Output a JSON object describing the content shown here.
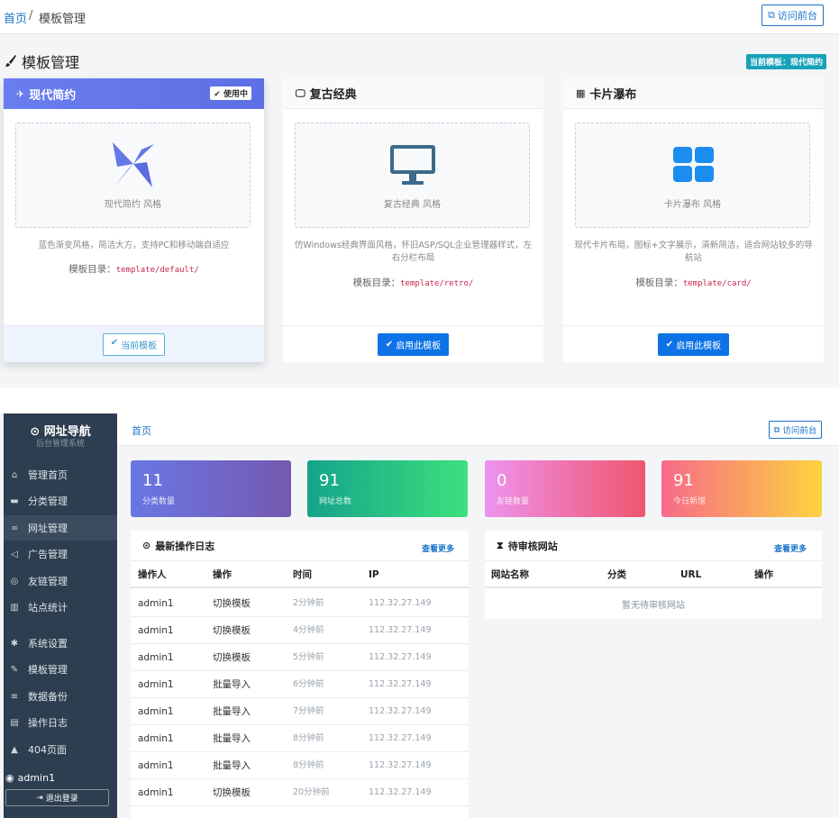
{
  "header": {
    "breadcrumb_home": "首页",
    "breadcrumb_sep": "/",
    "breadcrumb_current": "模板管理",
    "visit_button": "访问前台"
  },
  "page": {
    "title": "模板管理",
    "current_badge": "当前模板：现代简约"
  },
  "templates": [
    {
      "name": "现代简约",
      "badge": "使用中",
      "preview_label": "现代简约 风格",
      "desc": "蓝色渐变风格，简洁大方，支持PC和移动端自适应",
      "dir_label": "模板目录：",
      "dir": "template/default/",
      "button": "当前模板",
      "icon": "paper-plane-icon",
      "active": true
    },
    {
      "name": "复古经典",
      "preview_label": "复古经典 风格",
      "desc": "仿Windows经典界面风格，怀旧ASP/SQL企业管理器样式，左右分栏布局",
      "dir_label": "模板目录：",
      "dir": "template/retro/",
      "button": "启用此模板",
      "icon": "monitor-icon",
      "active": false
    },
    {
      "name": "卡片瀑布",
      "preview_label": "卡片瀑布 风格",
      "desc": "现代卡片布局，图标+文字展示，清新简洁，适合网站较多的导航站",
      "dir_label": "模板目录：",
      "dir": "template/card/",
      "button": "启用此模板",
      "icon": "grid-icon",
      "active": false
    }
  ],
  "sidebar": {
    "brand": "网址导航",
    "subtitle": "后台管理系统",
    "items": [
      {
        "label": "管理首页",
        "icon": "home-icon"
      },
      {
        "label": "分类管理",
        "icon": "folder-icon"
      },
      {
        "label": "网址管理",
        "icon": "link-icon"
      },
      {
        "label": "广告管理",
        "icon": "bullhorn-icon"
      },
      {
        "label": "友链管理",
        "icon": "handshake-icon"
      },
      {
        "label": "站点统计",
        "icon": "bar-chart-icon"
      },
      {
        "label": "系统设置",
        "icon": "gear-icon"
      },
      {
        "label": "模板管理",
        "icon": "brush-icon"
      },
      {
        "label": "数据备份",
        "icon": "database-icon"
      },
      {
        "label": "操作日志",
        "icon": "file-icon"
      },
      {
        "label": "404页面",
        "icon": "warning-icon"
      }
    ],
    "user": "admin1",
    "logout": "退出登录"
  },
  "dashboard": {
    "breadcrumb": "首页",
    "visit_button": "访问前台",
    "stats": [
      {
        "value": "11",
        "label": "分类数量"
      },
      {
        "value": "91",
        "label": "网址总数"
      },
      {
        "value": "0",
        "label": "友链数量"
      },
      {
        "value": "91",
        "label": "今日新增"
      }
    ],
    "log": {
      "title": "最新操作日志",
      "more": "查看更多",
      "columns": [
        "操作人",
        "操作",
        "时间",
        "IP"
      ],
      "rows": [
        [
          "admin1",
          "切换模板",
          "2分钟前",
          "112.32.27.149"
        ],
        [
          "admin1",
          "切换模板",
          "4分钟前",
          "112.32.27.149"
        ],
        [
          "admin1",
          "切换模板",
          "5分钟前",
          "112.32.27.149"
        ],
        [
          "admin1",
          "批量导入",
          "6分钟前",
          "112.32.27.149"
        ],
        [
          "admin1",
          "批量导入",
          "7分钟前",
          "112.32.27.149"
        ],
        [
          "admin1",
          "批量导入",
          "8分钟前",
          "112.32.27.149"
        ],
        [
          "admin1",
          "批量导入",
          "8分钟前",
          "112.32.27.149"
        ],
        [
          "admin1",
          "切换模板",
          "20分钟前",
          "112.32.27.149"
        ]
      ]
    },
    "pending": {
      "title": "待审核网站",
      "more": "查看更多",
      "columns": [
        "网站名称",
        "分类",
        "URL",
        "操作"
      ],
      "empty": "暂无待审核网站"
    }
  }
}
